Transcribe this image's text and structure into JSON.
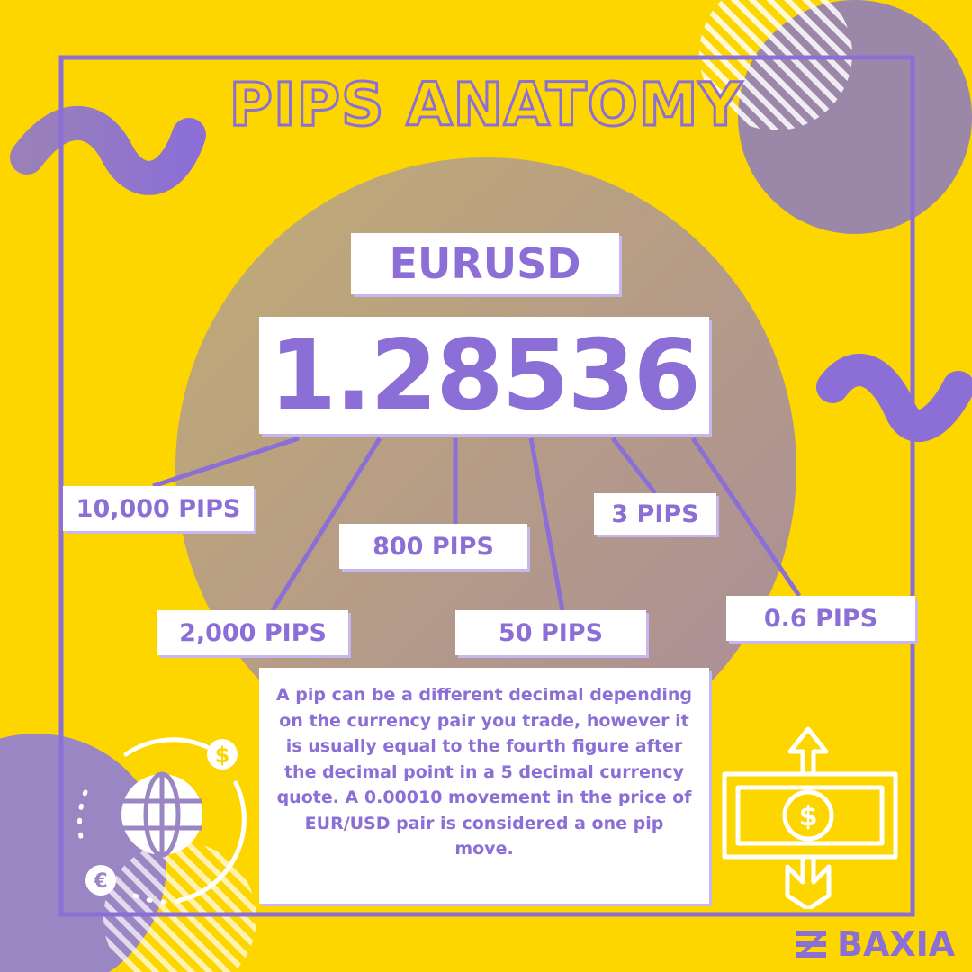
{
  "title": "PIPS ANATOMY",
  "pair": "EURUSD",
  "price": "1.28536",
  "pips": [
    "10,000 PIPS",
    "2,000 PIPS",
    "800 PIPS",
    "50 PIPS",
    "3 PIPS",
    "0.6 PIPS"
  ],
  "info_text": "A pip can be a different decimal depending on the currency pair you trade, however it is usually equal to the fourth figure after the decimal point in a 5 decimal currency quote. A 0.00010 movement in the price of EUR/USD pair is considered a one pip move.",
  "brand": "BAXIA",
  "icons": {
    "dollar_coin": "$",
    "euro_coin": "€",
    "banknote_dollar": "$"
  },
  "colors": {
    "background": "#FDD600",
    "accent": "#8B6FD6",
    "box": "#FFFFFF"
  }
}
